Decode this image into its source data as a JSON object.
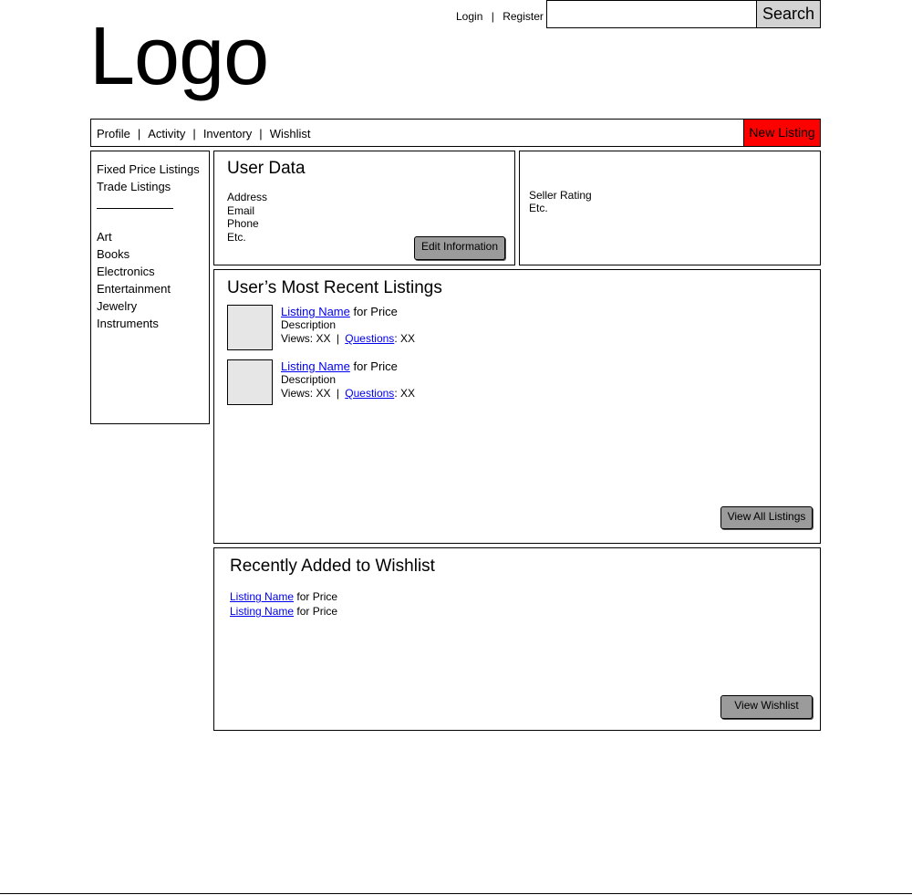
{
  "header": {
    "logo_text": "Logo",
    "login_label": "Login",
    "separator": "|",
    "register_label": "Register",
    "search_value": "",
    "search_placeholder": "",
    "search_button": "Search"
  },
  "nav": {
    "items": [
      {
        "label": "Profile"
      },
      {
        "label": "Activity"
      },
      {
        "label": "Inventory"
      },
      {
        "label": "Wishlist"
      }
    ],
    "separator": "|",
    "new_listing_label": "New Listing"
  },
  "sidebar": {
    "listing_types": [
      {
        "label": "Fixed Price Listings"
      },
      {
        "label": "Trade Listings"
      }
    ],
    "categories": [
      {
        "label": "Art"
      },
      {
        "label": "Books"
      },
      {
        "label": "Electronics"
      },
      {
        "label": "Entertainment"
      },
      {
        "label": "Jewelry"
      },
      {
        "label": "Instruments"
      }
    ]
  },
  "user_data": {
    "title": "User Data",
    "fields": [
      "Address",
      "Email",
      "Phone",
      "Etc."
    ],
    "edit_button": "Edit Information"
  },
  "seller": {
    "lines": [
      "Seller Rating",
      "Etc."
    ]
  },
  "recent_listings": {
    "title": "User’s Most Recent Listings",
    "items": [
      {
        "name": "Listing Name",
        "price_text": " for Price",
        "description": "Description",
        "views_label": "Views: XX",
        "sep": "|",
        "questions_label": "Questions",
        "questions_value": ": XX"
      },
      {
        "name": "Listing Name",
        "price_text": " for Price",
        "description": "Description",
        "views_label": "Views: XX",
        "sep": "|",
        "questions_label": "Questions",
        "questions_value": ": XX"
      }
    ],
    "view_all_button": "View All Listings"
  },
  "wishlist": {
    "title": "Recently Added to Wishlist",
    "items": [
      {
        "name": "Listing Name",
        "price_text": " for Price"
      },
      {
        "name": "Listing Name",
        "price_text": " for Price"
      }
    ],
    "view_button": "View Wishlist"
  },
  "colors": {
    "accent_new_listing": "#ff0000",
    "button_gray": "#9b9b9b",
    "search_button_bg": "#d3d3d3",
    "link": "#0000ee"
  }
}
